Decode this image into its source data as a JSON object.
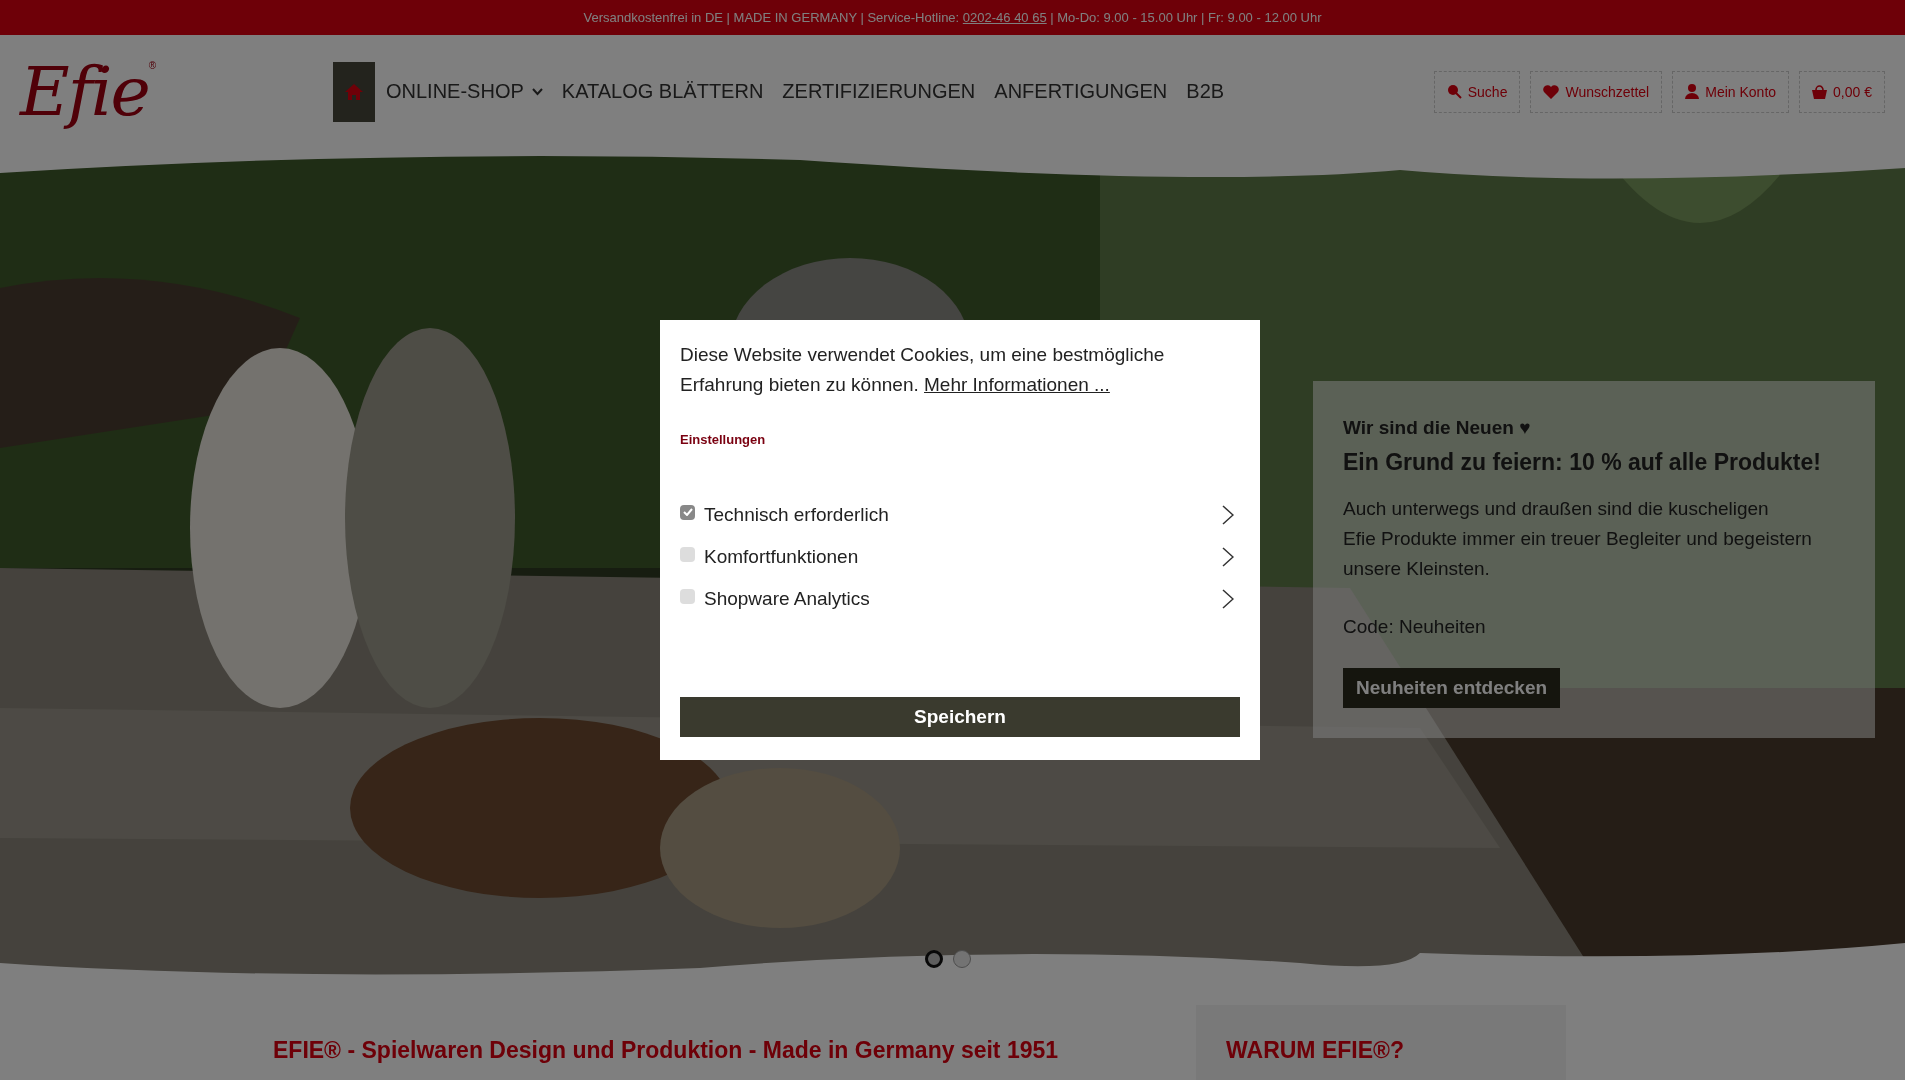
{
  "top_bar": {
    "text_before": "Versandkostenfrei in DE | MADE IN GERMANY | Service-Hotline:",
    "hotline": "0202-46 40 65",
    "text_after": "| Mo-Do: 9.00 - 15.00 Uhr | Fr: 9.00 - 12.00 Uhr"
  },
  "header": {
    "logo": "Efie",
    "logo_mark": "®",
    "nav": [
      {
        "label": "ONLINE-SHOP",
        "dropdown": true
      },
      {
        "label": "KATALOG BLÄTTERN",
        "dropdown": false
      },
      {
        "label": "ZERTIFIZIERUNGEN",
        "dropdown": false
      },
      {
        "label": "ANFERTIGUNGEN",
        "dropdown": false
      },
      {
        "label": "B2B",
        "dropdown": false
      }
    ],
    "actions": [
      {
        "kind": "search",
        "label": "Suche"
      },
      {
        "kind": "wishlist",
        "label": "Wunschzettel"
      },
      {
        "kind": "account",
        "label": "Mein Konto"
      },
      {
        "kind": "cart",
        "label": "0,00 €"
      }
    ]
  },
  "hero": {
    "card": {
      "kicker": "Wir sind die Neuen ♥",
      "title": "Ein Grund zu feiern: 10 % auf alle Produkte!",
      "body": [
        "Auch unterwegs und draußen sind die kuscheligen",
        "Efie Produkte immer ein treuer Begleiter und begeistern unsere Kleinsten."
      ],
      "code": "Code: Neuheiten",
      "button": "Neuheiten entdecken"
    },
    "dots": [
      {
        "selected": true
      },
      {
        "selected": false
      }
    ]
  },
  "content": {
    "heading": "EFIE® - Spielwaren Design und Produktion - Made in Germany seit 1951",
    "aside_heading": "WARUM EFIE®?"
  },
  "cookie_dialog": {
    "text": "Diese Website verwendet Cookies, um eine bestmögliche Erfahrung bieten zu können.",
    "link": "Mehr Informationen ...",
    "settings_label": "Einstellungen",
    "options": [
      {
        "label": "Technisch erforderlich",
        "checked": true
      },
      {
        "label": "Komfortfunktionen",
        "checked": false
      },
      {
        "label": "Shopware Analytics",
        "checked": false
      }
    ],
    "save_button": "Speichern"
  }
}
